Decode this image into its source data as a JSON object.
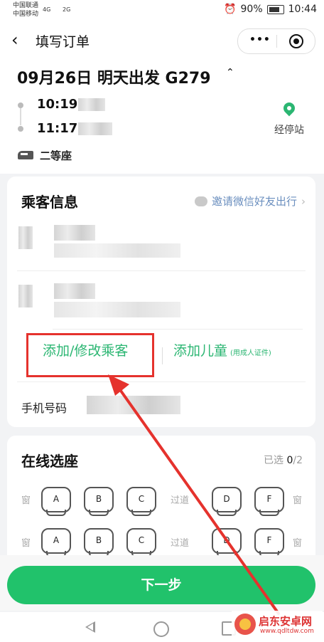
{
  "status": {
    "carrier1": "中国联通",
    "carrier2": "中国移动",
    "sig1": "4G",
    "sig2": "2G",
    "battery": "90%",
    "time": "10:44"
  },
  "header": {
    "back_icon": "chevron-left-icon",
    "title": "填写订单"
  },
  "trip": {
    "date_line": "09月26日 明天出发 G279",
    "depart_time": "10:19",
    "arrive_time": "11:17",
    "stations_label": "经停站",
    "seat_class": "二等座"
  },
  "passengers": {
    "title": "乘客信息",
    "invite": "邀请微信好友出行",
    "add_edit_label": "添加/修改乘客",
    "add_child_label": "添加儿童",
    "add_child_note": "(用成人证件)",
    "phone_label": "手机号码"
  },
  "seat_select": {
    "title": "在线选座",
    "selected_prefix": "已选",
    "selected_count": "0",
    "selected_total": "/2",
    "window_label": "窗",
    "aisle_label": "过道",
    "rows": [
      [
        "A",
        "B",
        "C",
        "D",
        "F"
      ],
      [
        "A",
        "B",
        "C",
        "D",
        "F"
      ]
    ]
  },
  "next_button": "下一步",
  "watermark": {
    "brand": "启东安卓网",
    "url": "www.qdltdw.com"
  },
  "colors": {
    "accent": "#21c26b",
    "highlight": "#e5322d",
    "link": "#6b8fbf"
  }
}
